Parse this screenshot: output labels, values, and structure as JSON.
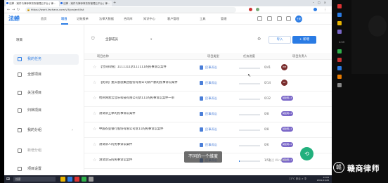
{
  "browser": {
    "tabs": [
      {
        "label": "法蝉 - 案件与律师事务所管理云平台 | 律..."
      },
      {
        "label": "法蝉 - 案件与律师事务所管理云平台 | 律..."
      }
    ],
    "url": "https://work.fachans.com/v3/project/list"
  },
  "app": {
    "logo": "法蝉",
    "nav": [
      "首页",
      "项目",
      "记账报单",
      "法律大数据",
      "合同库",
      "知识中心",
      "客户管理",
      "工具",
      "管理"
    ],
    "active_nav": "项目",
    "user_avatar": "王彬"
  },
  "sidebar": {
    "header": "项目",
    "items": [
      {
        "label": "我的任务",
        "active": true,
        "icon": "user-icon"
      },
      {
        "label": "全部项目",
        "active": false,
        "icon": "folder-icon"
      },
      {
        "label": "关注项目",
        "active": false,
        "icon": "star-icon"
      },
      {
        "label": "归档项目",
        "active": false,
        "icon": "archive-icon"
      },
      {
        "label": "我的分组",
        "active": false,
        "icon": "group-icon",
        "chevron": "›"
      },
      {
        "label": "新增分组",
        "active": false,
        "icon": "plus-icon"
      },
      {
        "label": "项目设置",
        "active": false,
        "icon": "gear-icon"
      }
    ]
  },
  "toolbar": {
    "filter": "全部成员",
    "import_label": "导入",
    "new_label": "+ 新增"
  },
  "table": {
    "headers": [
      "项目名称",
      "项目类型",
      "任务进度",
      "项目负责人"
    ],
    "rows": [
      {
        "name": "【合同纠纷】1111111诉111111的民事诉讼案件",
        "type": "民事诉讼",
        "progress_text": "0/41",
        "progress": 0.0,
        "owner": "WB"
      },
      {
        "name": "【民诉】重庆恩思集团股份有限公司诉严鹏的民事诉讼案件",
        "type": "民事诉讼",
        "progress_text": "0/14",
        "progress": 0.0,
        "owner": "LX"
      },
      {
        "name": "杭州网易云音乐科技有限公司诉111的民事诉讼案件一审",
        "type": "民事诉讼",
        "progress_text": "0/32",
        "progress": 0.0,
        "owner": "胡建明+2"
      },
      {
        "name": "测试诉王律的民事诉讼案件",
        "type": "民事诉讼",
        "progress_text": "0/8",
        "progress": 0.0,
        "owner": "胡建明+3"
      },
      {
        "name": "中国农业银行股份有限公司诉11的民事诉讼案件",
        "type": "民事诉讼",
        "progress_text": "0/8",
        "progress": 0.0,
        "owner": "胡建明+1"
      },
      {
        "name": "测试诉人的民事诉讼案件",
        "type": "民事诉讼",
        "progress_text": "0/6",
        "progress": 0.0,
        "owner": "胡建明+2"
      },
      {
        "name": "测试诉与的民事诉讼案件",
        "type": "民事诉讼",
        "progress_text": "1/51",
        "progress": 0.02,
        "owner": "胡建明+1"
      }
    ]
  },
  "overlay": {
    "subtitle": "不同的一个维度",
    "activate_windows": "激活 Windows"
  },
  "taskbar": {
    "search": "搜索",
    "time": "14:09",
    "date": "2021/11/26",
    "tray": "11°C 多云 ∧ 中"
  },
  "right": {
    "label": "1:33"
  },
  "watermark": {
    "logo_char": "赣",
    "text": "赣商律师"
  },
  "colors": {
    "accent": "#2a7be4",
    "fab": "#22b07d"
  }
}
